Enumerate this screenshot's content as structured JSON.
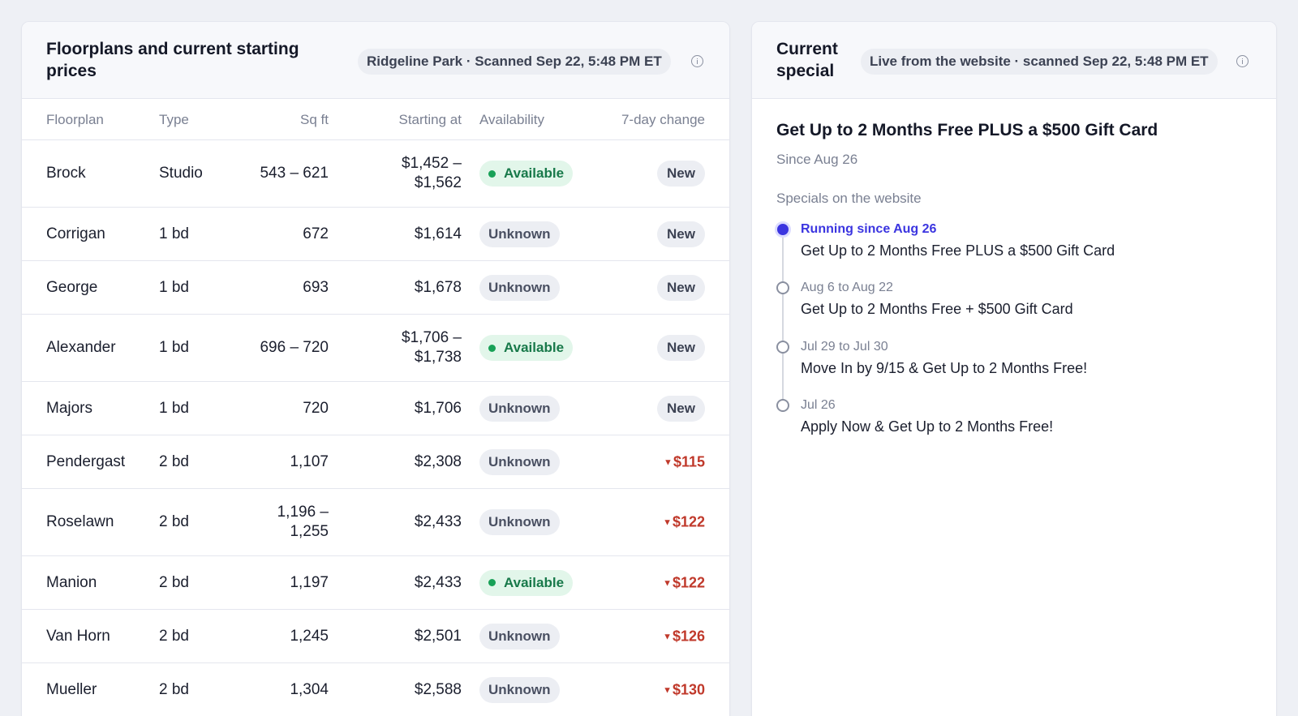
{
  "floorplans": {
    "title": "Floorplans and current starting prices",
    "scan_badge": "Ridgeline Park · Scanned Sep 22, 5:48 PM ET",
    "columns": [
      "Floorplan",
      "Type",
      "Sq ft",
      "Starting at",
      "Availability",
      "7-day change"
    ],
    "rows": [
      {
        "name": "Brock",
        "type": "Studio",
        "sqft": "543 – 621",
        "price": "$1,452 –\n$1,562",
        "availability": "Available",
        "change": "New"
      },
      {
        "name": "Corrigan",
        "type": "1 bd",
        "sqft": "672",
        "price": "$1,614",
        "availability": "Unknown",
        "change": "New"
      },
      {
        "name": "George",
        "type": "1 bd",
        "sqft": "693",
        "price": "$1,678",
        "availability": "Unknown",
        "change": "New"
      },
      {
        "name": "Alexander",
        "type": "1 bd",
        "sqft": "696 – 720",
        "price": "$1,706 –\n$1,738",
        "availability": "Available",
        "change": "New"
      },
      {
        "name": "Majors",
        "type": "1 bd",
        "sqft": "720",
        "price": "$1,706",
        "availability": "Unknown",
        "change": "New"
      },
      {
        "name": "Pendergast",
        "type": "2 bd",
        "sqft": "1,107",
        "price": "$2,308",
        "availability": "Unknown",
        "change": "$115"
      },
      {
        "name": "Roselawn",
        "type": "2 bd",
        "sqft": "1,196 –\n1,255",
        "price": "$2,433",
        "availability": "Unknown",
        "change": "$122"
      },
      {
        "name": "Manion",
        "type": "2 bd",
        "sqft": "1,197",
        "price": "$2,433",
        "availability": "Available",
        "change": "$122"
      },
      {
        "name": "Van Horn",
        "type": "2 bd",
        "sqft": "1,245",
        "price": "$2,501",
        "availability": "Unknown",
        "change": "$126"
      },
      {
        "name": "Mueller",
        "type": "2 bd",
        "sqft": "1,304",
        "price": "$2,588",
        "availability": "Unknown",
        "change": "$130"
      }
    ]
  },
  "special": {
    "title": "Current special",
    "source_badge": "Live from the website · scanned Sep 22, 5:48 PM ET",
    "headline": "Get Up to 2 Months Free PLUS a $500 Gift Card",
    "since": "Since Aug 26",
    "list_label": "Specials on the website",
    "timeline": [
      {
        "date": "Running since Aug 26",
        "text": "Get Up to 2 Months Free PLUS a $500 Gift Card",
        "active": true
      },
      {
        "date": "Aug 6 to Aug 22",
        "text": "Get Up to 2 Months Free + $500 Gift Card",
        "active": false
      },
      {
        "date": "Jul 29 to Jul 30",
        "text": "Move In by 9/15 & Get Up to 2 Months Free!",
        "active": false
      },
      {
        "date": "Jul 26",
        "text": "Apply Now & Get Up to 2 Months Free!",
        "active": false
      }
    ]
  },
  "icons": {
    "info": "info-icon",
    "price_drop": "down-triangle-icon",
    "available_dot": "status-dot-icon"
  },
  "colors": {
    "accent": "#3b35e0",
    "available_bg": "#e2f6ea",
    "available_text": "#18794a",
    "decrease": "#c0392b"
  }
}
